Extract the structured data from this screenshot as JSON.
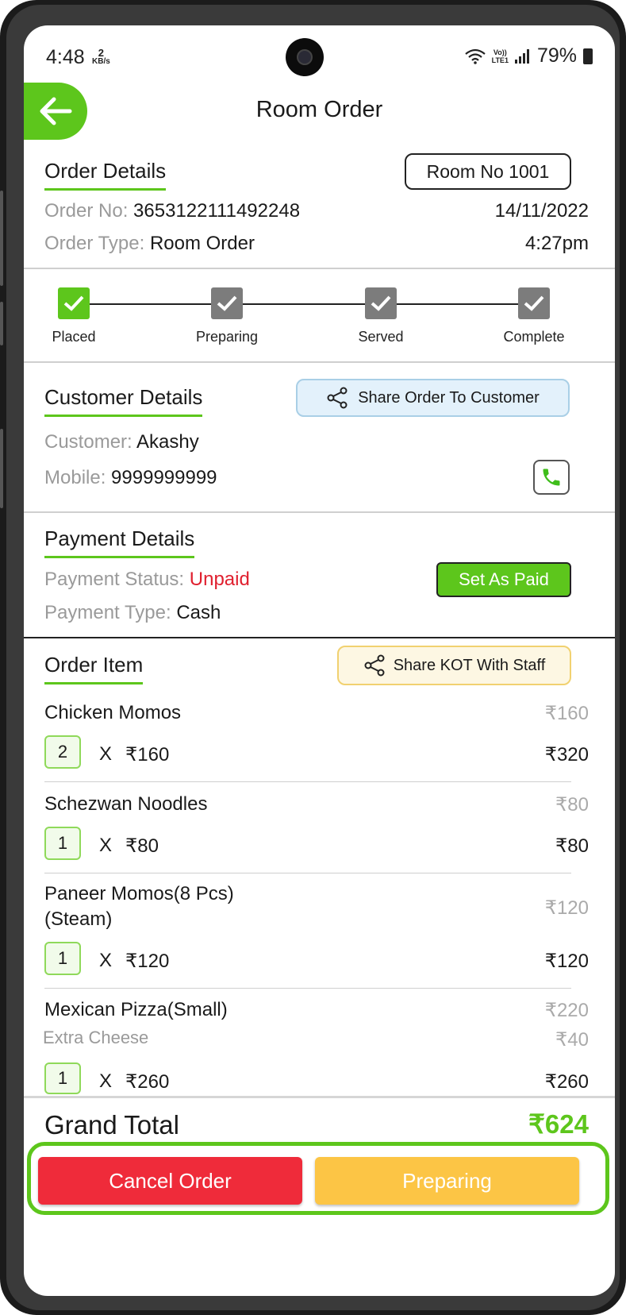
{
  "status_bar": {
    "time": "4:48",
    "data_speed_value": "2",
    "data_speed_unit": "KB/s",
    "network_label_top": "Vo))",
    "network_label_bottom": "LTE1",
    "battery": "79%"
  },
  "header": {
    "title": "Room Order"
  },
  "order_details": {
    "title": "Order Details",
    "room_button": "Room No 1001",
    "order_no_label": "Order No:",
    "order_no": "3653122111492248",
    "date": "14/11/2022",
    "order_type_label": "Order Type:",
    "order_type": "Room Order",
    "time": "4:27pm"
  },
  "progress": {
    "steps": [
      {
        "label": "Placed",
        "done": true
      },
      {
        "label": "Preparing",
        "done": false
      },
      {
        "label": "Served",
        "done": false
      },
      {
        "label": "Complete",
        "done": false
      }
    ]
  },
  "customer_details": {
    "title": "Customer Details",
    "share_button": "Share Order To Customer",
    "customer_label": "Customer:",
    "customer": "Akashy",
    "mobile_label": "Mobile:",
    "mobile": "9999999999"
  },
  "payment_details": {
    "title": "Payment Details",
    "status_label": "Payment Status:",
    "status": "Unpaid",
    "set_paid_button": "Set As Paid",
    "type_label": "Payment Type:",
    "type": "Cash"
  },
  "order_items": {
    "title": "Order Item",
    "share_kot_button": "Share KOT With Staff",
    "items": [
      {
        "name": "Chicken Momos",
        "unit_price": "₹160",
        "qty": "2",
        "x": "X",
        "rate": "₹160",
        "total": "₹320"
      },
      {
        "name": "Schezwan Noodles",
        "unit_price": "₹80",
        "qty": "1",
        "x": "X",
        "rate": "₹80",
        "total": "₹80"
      },
      {
        "name_line1": "Paneer Momos(8 Pcs)",
        "name_line2": "(Steam)",
        "unit_price": "₹120",
        "qty": "1",
        "x": "X",
        "rate": "₹120",
        "total": "₹120"
      },
      {
        "name": "Mexican Pizza(Small)",
        "unit_price": "₹220",
        "addon": "Extra Cheese",
        "addon_price": "₹40",
        "qty": "1",
        "x": "X",
        "rate": "₹260",
        "total": "₹260"
      }
    ]
  },
  "grand_total": {
    "label": "Grand Total",
    "value": "₹624"
  },
  "actions": {
    "cancel": "Cancel Order",
    "preparing": "Preparing"
  },
  "colors": {
    "accent": "#5dc61c",
    "cancel": "#ef2b3a",
    "preparing": "#fcc545",
    "unpaid": "#e0202f"
  }
}
